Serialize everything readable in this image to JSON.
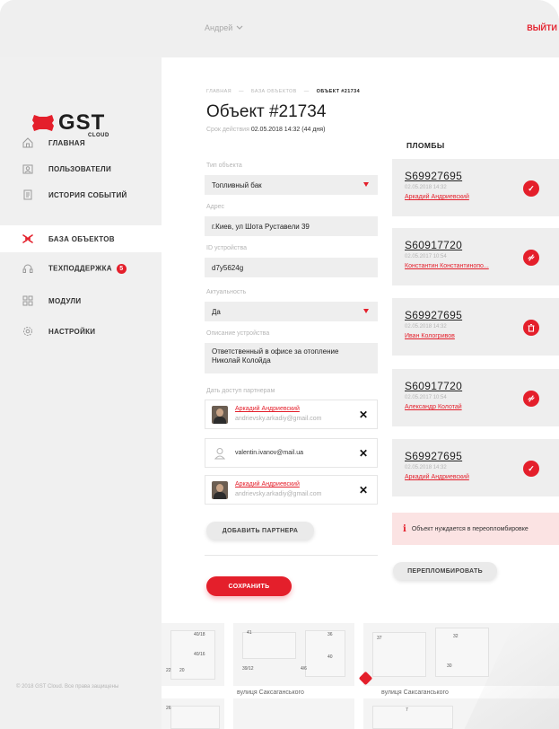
{
  "header": {
    "user_label": "Андрей",
    "logout_label": "ВЫЙТИ"
  },
  "logo": {
    "text": "GST",
    "sub": "CLOUD"
  },
  "sidebar": {
    "items": [
      {
        "label": "ГЛАВНАЯ",
        "icon": "home-icon"
      },
      {
        "label": "ПОЛЬЗОВАТЕЛИ",
        "icon": "users-icon"
      },
      {
        "label": "ИСТОРИЯ СОБЫТИЙ",
        "icon": "history-icon"
      },
      {
        "label": "БАЗА ОБЪЕКТОВ",
        "icon": "objects-icon",
        "active": true
      },
      {
        "label": "ТЕХПОДДЕРЖКА",
        "icon": "support-icon",
        "badge": "5"
      },
      {
        "label": "МОДУЛИ",
        "icon": "modules-icon"
      },
      {
        "label": "НАСТРОЙКИ",
        "icon": "settings-icon"
      }
    ],
    "copyright": "© 2018 GST Cloud. Все права защищены"
  },
  "breadcrumb": {
    "home": "ГЛАВНАЯ",
    "section": "БАЗА ОБЪЕКТОВ",
    "current": "ОБЪЕКТ #21734"
  },
  "page": {
    "title": "Объект #21734",
    "term_label": "Срок действия",
    "term_value": "02.05.2018 14:32 (44 дня)"
  },
  "form": {
    "type_label": "Тип объекта",
    "type_value": "Топливный бак",
    "address_label": "Адрес",
    "address_value": "г.Киев, ул Шота Руставели 39",
    "device_label": "ID устройства",
    "device_value": "d7y5624g",
    "actual_label": "Актуальность",
    "actual_value": "Да",
    "desc_label": "Описание устройства",
    "desc_line1": "Ответственный в офисе за отопление",
    "desc_line2": "Николай Колойда",
    "access_label": "Дать доступ партнерам",
    "partners": [
      {
        "name": "Аркадий Андриевский",
        "email": "andrievsky.arkadiy@gmail.com"
      },
      {
        "name": "",
        "email": "valentin.ivanov@mail.ua"
      },
      {
        "name": "Аркадий Андриевский",
        "email": "andrievsky.arkadiy@gmail.com"
      }
    ],
    "add_partner_label": "ДОБАВИТЬ ПАРТНЕРА",
    "save_label": "СОХРАНИТЬ"
  },
  "seals": {
    "title": "ПЛОМБЫ",
    "items": [
      {
        "number": "S69927695",
        "date": "02.05.2018 14:32",
        "person": "Аркадий Андриевский",
        "status": "ok"
      },
      {
        "number": "S60917720",
        "date": "02.05.2017 10:54",
        "person": "Константин Константинопо...",
        "status": "broken"
      },
      {
        "number": "S69927695",
        "date": "02.05.2018 14:32",
        "person": "Иван Кологривов",
        "status": "deleted"
      },
      {
        "number": "S60917720",
        "date": "02.05.2017 10:54",
        "person": "Александр Колотай",
        "status": "broken"
      },
      {
        "number": "S69927695",
        "date": "02.05.2018 14:32",
        "person": "Аркадий Андриевский",
        "status": "ok"
      }
    ],
    "alert": "Объект нуждается в переопломбировке",
    "reseal_label": "ПЕРЕПЛОМБИРОВАТЬ"
  },
  "map": {
    "street_1": "вулиця Саксаганського",
    "street_2": "вулиця Саксаганського",
    "numbers": [
      "40/18",
      "40/16",
      "22",
      "20",
      "41",
      "36",
      "40",
      "37",
      "39/12",
      "4/6",
      "32",
      "30",
      "26",
      "7"
    ]
  },
  "colors": {
    "accent": "#e41f2b",
    "sidebar": "#f0f0f0",
    "field": "#eeeeee"
  }
}
